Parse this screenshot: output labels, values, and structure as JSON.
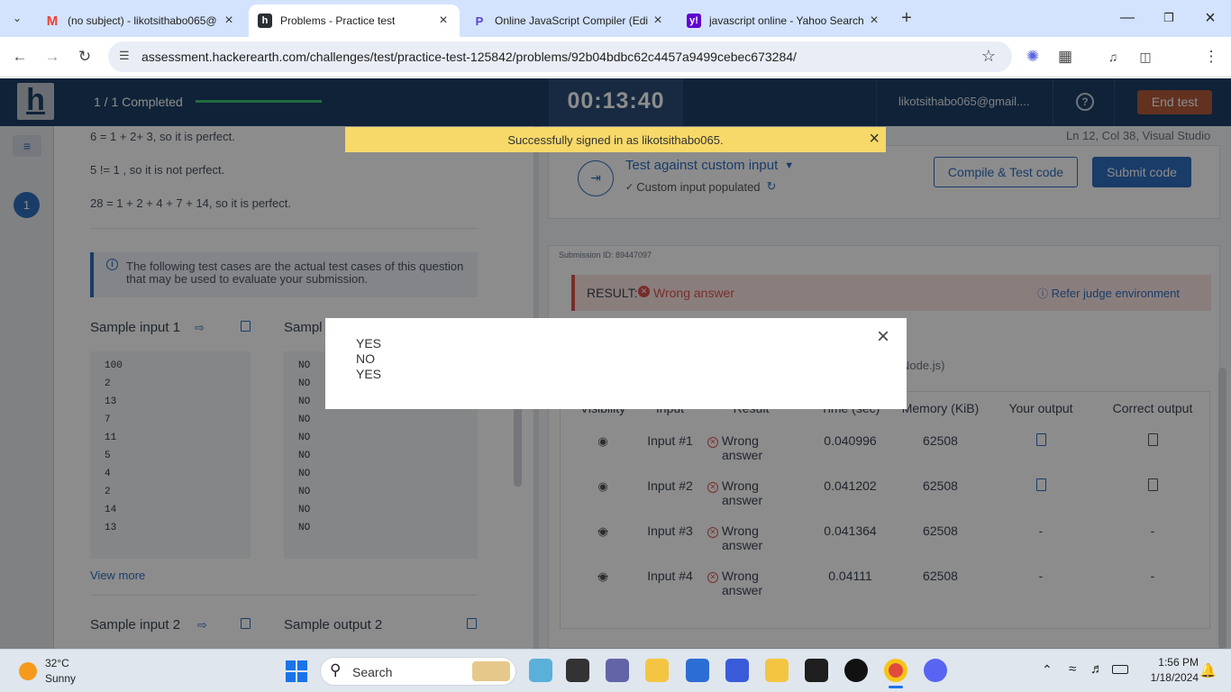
{
  "browser": {
    "tabs": [
      {
        "title": "(no subject) - likotsithabo065@",
        "icon": "gmail-icon",
        "active": false
      },
      {
        "title": "Problems - Practice test",
        "icon": "hackerearth-icon",
        "active": true
      },
      {
        "title": "Online JavaScript Compiler (Edi",
        "icon": "programiz-icon",
        "active": false
      },
      {
        "title": "javascript online - Yahoo Search",
        "icon": "yahoo-icon",
        "active": false
      }
    ],
    "url": "assessment.hackerearth.com/challenges/test/practice-test-125842/problems/92b04bdbc62c4457a9499cebec673284/"
  },
  "header": {
    "logo": "h",
    "progress_text": "1 / 1 Completed",
    "progress_fraction": 1.0,
    "timer": "00:13:40",
    "user": "likotsithabo065@gmail....",
    "end_test": "End test"
  },
  "toast": {
    "message": "Successfully signed in as likotsithabo065."
  },
  "editor": {
    "status": "Ln 12, Col 38, Visual Studio"
  },
  "sidebar": {
    "question_number": "1"
  },
  "problem": {
    "examples": [
      "6 = 1 + 2+ 3, so it is perfect.",
      "5 != 1 , so it is not perfect.",
      "28 = 1 + 2 + 4 + 7 + 14, so it is perfect."
    ],
    "info_note": "The following test cases are the actual test cases of this question that may be used to evaluate your submission.",
    "sample_input_1_label": "Sample input 1",
    "sample_output_1_label": "Sampl",
    "sample_input_1": [
      "100",
      "2",
      "13",
      "7",
      "11",
      "5",
      "4",
      "2",
      "14",
      "13"
    ],
    "sample_output_1": [
      "NO",
      "NO",
      "NO",
      "NO",
      "NO",
      "NO",
      "NO",
      "NO",
      "NO",
      "NO"
    ],
    "view_more": "View more",
    "sample_input_2_label": "Sample input 2",
    "sample_output_2_label": "Sample output 2"
  },
  "actions": {
    "custom_input_label": "Test against custom input",
    "custom_input_status": "Custom input populated",
    "compile_button": "Compile & Test code",
    "submit_button": "Submit code"
  },
  "submission": {
    "id_text": "Submission ID: 89447097",
    "result_label": "RESULT:",
    "result_value": "Wrong answer",
    "refer_link": "Refer judge environment",
    "lang_partial": "Node.js)",
    "columns": [
      "Visibility",
      "Input",
      "Result",
      "Time (sec)",
      "Memory (KiB)",
      "Your output",
      "Correct output"
    ],
    "rows": [
      {
        "visibility": "eye-icon",
        "input": "Input #1",
        "result_line1": "Wrong",
        "result_line2": "answer",
        "time": "0.040996",
        "memory": "62508",
        "your_output": "doc-icon",
        "correct_output": "doc-icon"
      },
      {
        "visibility": "eye-icon",
        "input": "Input #2",
        "result_line1": "Wrong",
        "result_line2": "answer",
        "time": "0.041202",
        "memory": "62508",
        "your_output": "doc-icon",
        "correct_output": "doc-icon"
      },
      {
        "visibility": "eye-slash-icon",
        "input": "Input #3",
        "result_line1": "Wrong",
        "result_line2": "answer",
        "time": "0.041364",
        "memory": "62508",
        "your_output": "-",
        "correct_output": "-"
      },
      {
        "visibility": "eye-slash-icon",
        "input": "Input #4",
        "result_line1": "Wrong",
        "result_line2": "answer",
        "time": "0.04111",
        "memory": "62508",
        "your_output": "-",
        "correct_output": "-"
      }
    ]
  },
  "modal": {
    "lines": [
      "YES",
      "NO",
      "YES"
    ]
  },
  "taskbar": {
    "weather_temp": "32°C",
    "weather_desc": "Sunny",
    "search_placeholder": "Search",
    "time": "1:56 PM",
    "date": "1/18/2024"
  },
  "colors": {
    "header": "#1d3f66",
    "accent": "#2f6ebf",
    "end_test": "#b35a3a",
    "toast": "#f7d96a",
    "error": "#d9534f"
  }
}
